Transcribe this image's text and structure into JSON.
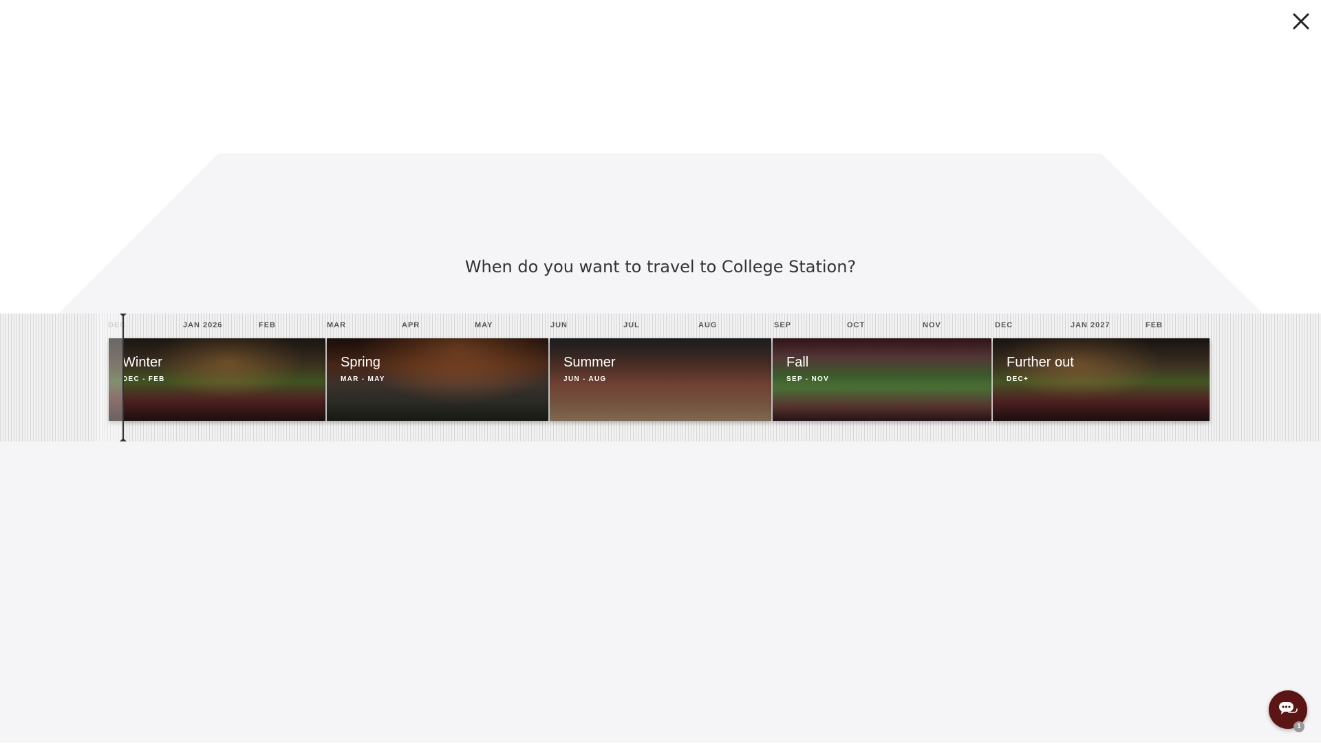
{
  "dialog": {
    "question": "When do you want to travel to College Station?",
    "close_icon": "close-icon"
  },
  "timeline": {
    "months": [
      {
        "label": "DEC",
        "faded": true
      },
      {
        "label": "JAN 2026"
      },
      {
        "label": "FEB"
      },
      {
        "label": "MAR"
      },
      {
        "label": "APR"
      },
      {
        "label": "MAY"
      },
      {
        "label": "JUN"
      },
      {
        "label": "JUL"
      },
      {
        "label": "AUG"
      },
      {
        "label": "SEP"
      },
      {
        "label": "OCT"
      },
      {
        "label": "NOV"
      },
      {
        "label": "DEC"
      },
      {
        "label": "JAN 2027"
      },
      {
        "label": "FEB"
      }
    ],
    "seasons": [
      {
        "title": "Winter",
        "range": "DEC - FEB"
      },
      {
        "title": "Spring",
        "range": "MAR - MAY"
      },
      {
        "title": "Summer",
        "range": "JUN - AUG"
      },
      {
        "title": "Fall",
        "range": "SEP - NOV"
      },
      {
        "title": "Further out",
        "range": "DEC+"
      }
    ]
  },
  "chat": {
    "icon": "chat-bubbles-icon",
    "badge": "1",
    "accent_color": "#5c1515"
  }
}
